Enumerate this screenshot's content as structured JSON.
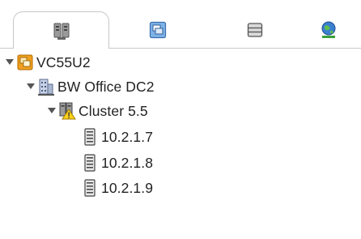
{
  "tabs": [
    {
      "icon": "hosts-and-clusters-icon",
      "active": true
    },
    {
      "icon": "vms-and-templates-icon",
      "active": false
    },
    {
      "icon": "storage-icon",
      "active": false
    },
    {
      "icon": "networking-icon",
      "active": false
    }
  ],
  "tree": {
    "root": {
      "label": "VC55U2",
      "expanded": true,
      "icon": "vcenter-icon"
    },
    "datacenter": {
      "label": "BW Office DC2",
      "expanded": true,
      "icon": "datacenter-icon"
    },
    "cluster": {
      "label": "Cluster 5.5",
      "expanded": true,
      "icon": "cluster-warning-icon"
    },
    "hosts": [
      {
        "label": "10.2.1.7",
        "icon": "host-icon"
      },
      {
        "label": "10.2.1.8",
        "icon": "host-icon"
      },
      {
        "label": "10.2.1.9",
        "icon": "host-icon"
      }
    ]
  },
  "colors": {
    "accent_orange": "#f0a020",
    "accent_blue": "#3a7fd0",
    "accent_green": "#3aa03a",
    "border": "#c8c8c8"
  }
}
